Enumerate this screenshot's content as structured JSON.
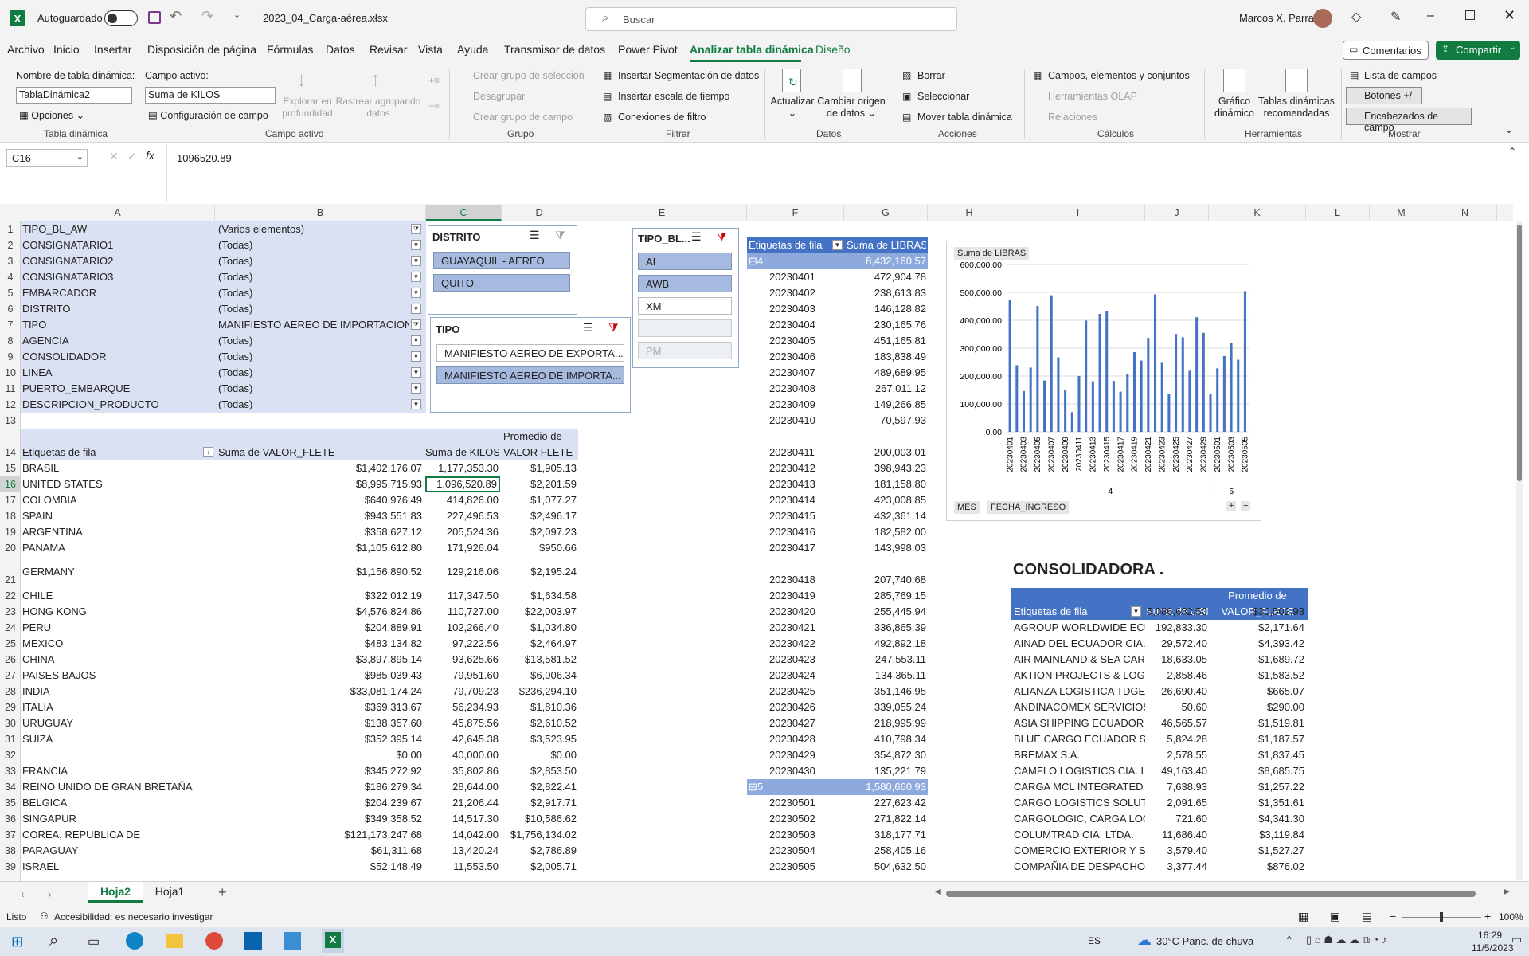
{
  "titlebar": {
    "autosave_label": "Autoguardado",
    "filename": "2023_04_Carga-aérea.xlsx",
    "search_placeholder": "Buscar",
    "user": "Marcos X. Parra"
  },
  "menu": [
    "Archivo",
    "Inicio",
    "Insertar",
    "Disposición de página",
    "Fórmulas",
    "Datos",
    "Revisar",
    "Vista",
    "Ayuda",
    "Transmisor de datos",
    "Power Pivot",
    "Analizar tabla dinámica",
    "Diseño"
  ],
  "menu_active": "Analizar tabla dinámica",
  "comments_label": "Comentarios",
  "share_label": "Compartir",
  "ribbon": {
    "pt_name_label": "Nombre de tabla dinámica:",
    "pt_name_value": "TablaDinámica2",
    "options_label": "Opciones",
    "group_pt": "Tabla dinámica",
    "active_field_label": "Campo activo:",
    "active_field_value": "Suma de KILOS",
    "field_config": "Configuración de campo",
    "drill_down": "Explorar en profundidad",
    "drill_up": "Rastrear agrupando datos",
    "group_active": "Campo activo",
    "create_sel_group": "Crear grupo de selección",
    "ungroup": "Desagrupar",
    "create_field_group": "Crear grupo de campo",
    "group_group": "Grupo",
    "insert_slicer": "Insertar Segmentación de datos",
    "insert_timeline": "Insertar escala de tiempo",
    "filter_connections": "Conexiones de filtro",
    "group_filter": "Filtrar",
    "refresh": "Actualizar",
    "change_source": "Cambiar origen de datos",
    "group_data": "Datos",
    "clear": "Borrar",
    "select": "Seleccionar",
    "move_pt": "Mover tabla dinámica",
    "group_actions": "Acciones",
    "fields_items": "Campos, elementos y conjuntos",
    "olap_tools": "Herramientas OLAP",
    "relations": "Relaciones",
    "group_calc": "Cálculos",
    "pivot_chart": "Gráfico dinámico",
    "recommended_pt": "Tablas dinámicas recomendadas",
    "group_tools": "Herramientas",
    "field_list": "Lista de campos",
    "buttons_pm": "Botones +/-",
    "field_headers": "Encabezados de campo",
    "group_show": "Mostrar"
  },
  "formula_bar": {
    "name_box": "C16",
    "formula": "1096520.89"
  },
  "col_headers": [
    "A",
    "B",
    "C",
    "D",
    "E",
    "F",
    "G",
    "H",
    "I",
    "J",
    "K",
    "L",
    "M",
    "N"
  ],
  "row_numbers": [
    "1",
    "2",
    "3",
    "4",
    "5",
    "6",
    "7",
    "8",
    "9",
    "10",
    "11",
    "12",
    "13",
    "14",
    "15",
    "16",
    "17",
    "18",
    "19",
    "20",
    "21",
    "22",
    "23",
    "24",
    "25",
    "26",
    "27",
    "28",
    "29",
    "30",
    "31",
    "32",
    "33",
    "34",
    "35",
    "36",
    "37",
    "38",
    "39"
  ],
  "filters": [
    [
      "TIPO_BL_AW",
      "(Varios elementos)"
    ],
    [
      "CONSIGNATARIO1",
      "(Todas)"
    ],
    [
      "CONSIGNATARIO2",
      "(Todas)"
    ],
    [
      "CONSIGNATARIO3",
      "(Todas)"
    ],
    [
      "EMBARCADOR",
      "(Todas)"
    ],
    [
      "DISTRITO",
      "(Todas)"
    ],
    [
      "TIPO",
      "MANIFIESTO AEREO DE IMPORTACION"
    ],
    [
      "AGENCIA",
      "(Todas)"
    ],
    [
      "CONSOLIDADOR",
      "(Todas)"
    ],
    [
      "LINEA",
      "(Todas)"
    ],
    [
      "PUERTO_EMBARQUE",
      "(Todas)"
    ],
    [
      "DESCRIPCION_PRODUCTO",
      "(Todas)"
    ]
  ],
  "pivot1": {
    "h_rows": "Etiquetas de fila",
    "h_flete": "Suma de VALOR_FLETE",
    "h_kilos": "Suma de KILOS",
    "h_prom1": "Promedio de",
    "h_prom2": "VALOR FLETE",
    "rows": [
      [
        "BRASIL",
        "$1,402,176.07",
        "1,177,353.30",
        "$1,905.13"
      ],
      [
        "UNITED STATES",
        "$8,995,715.93",
        "1,096,520.89",
        "$2,201.59"
      ],
      [
        "COLOMBIA",
        "$640,976.49",
        "414,826.00",
        "$1,077.27"
      ],
      [
        "SPAIN",
        "$943,551.83",
        "227,496.53",
        "$2,496.17"
      ],
      [
        "ARGENTINA",
        "$358,627.12",
        "205,524.36",
        "$2,097.23"
      ],
      [
        "PANAMA",
        "$1,105,612.80",
        "171,926.04",
        "$950.66"
      ],
      [
        "GERMANY",
        "$1,156,890.52",
        "129,216.06",
        "$2,195.24"
      ],
      [
        "CHILE",
        "$322,012.19",
        "117,347.50",
        "$1,634.58"
      ],
      [
        "HONG KONG",
        "$4,576,824.86",
        "110,727.00",
        "$22,003.97"
      ],
      [
        "PERU",
        "$204,889.91",
        "102,266.40",
        "$1,034.80"
      ],
      [
        "MEXICO",
        "$483,134.82",
        "97,222.56",
        "$2,464.97"
      ],
      [
        "CHINA",
        "$3,897,895.14",
        "93,625.66",
        "$13,581.52"
      ],
      [
        "PAISES BAJOS",
        "$985,039.43",
        "79,951.60",
        "$6,006.34"
      ],
      [
        "INDIA",
        "$33,081,174.24",
        "79,709.23",
        "$236,294.10"
      ],
      [
        "ITALIA",
        "$369,313.67",
        "56,234.93",
        "$1,810.36"
      ],
      [
        "URUGUAY",
        "$138,357.60",
        "45,875.56",
        "$2,610.52"
      ],
      [
        "SUIZA",
        "$352,395.14",
        "42,645.38",
        "$3,523.95"
      ],
      [
        "",
        "$0.00",
        "40,000.00",
        "$0.00"
      ],
      [
        "FRANCIA",
        "$345,272.92",
        "35,802.86",
        "$2,853.50"
      ],
      [
        "REINO UNIDO DE GRAN BRETAÑA",
        "$186,279.34",
        "28,644.00",
        "$2,822.41"
      ],
      [
        "BELGICA",
        "$204,239.67",
        "21,206.44",
        "$2,917.71"
      ],
      [
        "SINGAPUR",
        "$349,358.52",
        "14,517.30",
        "$10,586.62"
      ],
      [
        "COREA, REPUBLICA DE",
        "$121,173,247.68",
        "14,042.00",
        "$1,756,134.02"
      ],
      [
        "PARAGUAY",
        "$61,311.68",
        "13,420.24",
        "$2,786.89"
      ],
      [
        "ISRAEL",
        "$52,148.49",
        "11,553.50",
        "$2,005.71"
      ]
    ]
  },
  "slicer_distrito": {
    "title": "DISTRITO",
    "items": [
      "GUAYAQUIL - AEREO",
      "QUITO"
    ]
  },
  "slicer_tipo": {
    "title": "TIPO",
    "items": [
      "MANIFIESTO AEREO DE EXPORTA...",
      "MANIFIESTO AEREO DE IMPORTA..."
    ]
  },
  "slicer_tipobl": {
    "title": "TIPO_BL...",
    "items": [
      "AI",
      "AWB",
      "XM",
      "",
      "PM"
    ]
  },
  "pivot2": {
    "h_rows": "Etiquetas de fila",
    "h_libras": "Suma de LIBRAS",
    "rows": [
      [
        "⊟4",
        "8,432,160.57"
      ],
      [
        "20230401",
        "472,904.78"
      ],
      [
        "20230402",
        "238,613.83"
      ],
      [
        "20230403",
        "146,128.82"
      ],
      [
        "20230404",
        "230,165.76"
      ],
      [
        "20230405",
        "451,165.81"
      ],
      [
        "20230406",
        "183,838.49"
      ],
      [
        "20230407",
        "489,689.95"
      ],
      [
        "20230408",
        "267,011.12"
      ],
      [
        "20230409",
        "149,266.85"
      ],
      [
        "20230410",
        "70,597.93"
      ],
      [
        "20230411",
        "200,003.01"
      ],
      [
        "20230412",
        "398,943.23"
      ],
      [
        "20230413",
        "181,158.80"
      ],
      [
        "20230414",
        "423,008.85"
      ],
      [
        "20230415",
        "432,361.14"
      ],
      [
        "20230416",
        "182,582.00"
      ],
      [
        "20230417",
        "143,998.03"
      ],
      [
        "20230418",
        "207,740.68"
      ],
      [
        "20230419",
        "285,769.15"
      ],
      [
        "20230420",
        "255,445.94"
      ],
      [
        "20230421",
        "336,865.39"
      ],
      [
        "20230422",
        "492,892.18"
      ],
      [
        "20230423",
        "247,553.11"
      ],
      [
        "20230424",
        "134,365.11"
      ],
      [
        "20230425",
        "351,146.95"
      ],
      [
        "20230426",
        "339,055.24"
      ],
      [
        "20230427",
        "218,995.99"
      ],
      [
        "20230428",
        "410,798.34"
      ],
      [
        "20230429",
        "354,872.30"
      ],
      [
        "20230430",
        "135,221.79"
      ],
      [
        "⊟5",
        "1,580,660.93"
      ],
      [
        "20230501",
        "227,623.42"
      ],
      [
        "20230502",
        "271,822.14"
      ],
      [
        "20230503",
        "318,177.71"
      ],
      [
        "20230504",
        "258,405.16"
      ],
      [
        "20230505",
        "504,632.50"
      ]
    ]
  },
  "chart_data": {
    "type": "bar",
    "legend_button": "Suma de LIBRAS",
    "y_ticks": [
      "600,000.00",
      "500,000.00",
      "400,000.00",
      "300,000.00",
      "200,000.00",
      "100,000.00",
      "0.00"
    ],
    "ylim": [
      0,
      600000
    ],
    "x_labels": [
      "20230401",
      "20230403",
      "20230405",
      "20230407",
      "20230409",
      "20230411",
      "20230413",
      "20230415",
      "20230417",
      "20230419",
      "20230421",
      "20230423",
      "20230425",
      "20230427",
      "20230429",
      "20230501",
      "20230503",
      "20230505"
    ],
    "groups": [
      "4",
      "5"
    ],
    "values": [
      472904.78,
      238613.83,
      146128.82,
      230165.76,
      451165.81,
      183838.49,
      489689.95,
      267011.12,
      149266.85,
      70597.93,
      200003.01,
      398943.23,
      181158.8,
      423008.85,
      432361.14,
      182582.0,
      143998.03,
      207740.68,
      285769.15,
      255445.94,
      336865.39,
      492892.18,
      247553.11,
      134365.11,
      351146.95,
      339055.24,
      218995.99,
      410798.34,
      354872.3,
      135221.79,
      227623.42,
      271822.14,
      318177.71,
      258405.16,
      504632.5
    ],
    "field_buttons": [
      "MES",
      "FECHA_INGRESO"
    ]
  },
  "consolidadora": {
    "title": "CONSOLIDADORA .",
    "h_rows": "Etiquetas de fila",
    "h_libras": "Suma de LIBI",
    "h_prom1": "Promedio de",
    "h_prom2": "VALOR_FLETE",
    "rows": [
      [
        "",
        "5,086,682.50",
        "$30,502.93"
      ],
      [
        "AGROUP WORLDWIDE ECU",
        "192,833.30",
        "$2,171.64"
      ],
      [
        "AINAD DEL ECUADOR CIA. L",
        "29,572.40",
        "$4,393.42"
      ],
      [
        "AIR MAINLAND & SEA CARG",
        "18,633.05",
        "$1,689.72"
      ],
      [
        "AKTION PROJECTS & LOGIST",
        "2,858.46",
        "$1,583.52"
      ],
      [
        "ALIANZA LOGISTICA TDGE S",
        "26,690.40",
        "$665.07"
      ],
      [
        "ANDINACOMEX SERVICIOS",
        "50.60",
        "$290.00"
      ],
      [
        "ASIA SHIPPING ECUADOR S",
        "46,565.57",
        "$1,519.81"
      ],
      [
        "BLUE CARGO ECUADOR S.A.",
        "5,824.28",
        "$1,187.57"
      ],
      [
        "BREMAX S.A.",
        "2,578.55",
        "$1,837.45"
      ],
      [
        "CAMFLO LOGISTICS CIA. LTI",
        "49,163.40",
        "$8,685.75"
      ],
      [
        "CARGA MCL INTEGRATED LC",
        "7,638.93",
        "$1,257.22"
      ],
      [
        "CARGO LOGISTICS SOLUTIO",
        "2,091.65",
        "$1,351.61"
      ],
      [
        "CARGOLOGIC, CARGA LOGIS",
        "721.60",
        "$4,341.30"
      ],
      [
        "COLUMTRAD CIA. LTDA.",
        "11,686.40",
        "$3,119.84"
      ],
      [
        "COMERCIO EXTERIOR Y SOL",
        "3,579.40",
        "$1,527.27"
      ],
      [
        "COMPAÑIA DE DESPACHOS",
        "3,377.44",
        "$876.02"
      ]
    ]
  },
  "sheet_tabs": [
    "Hoja2",
    "Hoja1"
  ],
  "status": {
    "ready": "Listo",
    "accessibility": "Accesibilidad: es necesario investigar",
    "zoom": "100%"
  },
  "taskbar": {
    "lang": "ES",
    "weather": "30°C  Panc. de chuva",
    "time": "16:29",
    "date": "11/5/2023"
  },
  "colors": {
    "excel_green": "#107c41",
    "pivot_header": "#d9e1f2",
    "pivot_band": "#8ea9db",
    "bar": "#4472c4"
  }
}
